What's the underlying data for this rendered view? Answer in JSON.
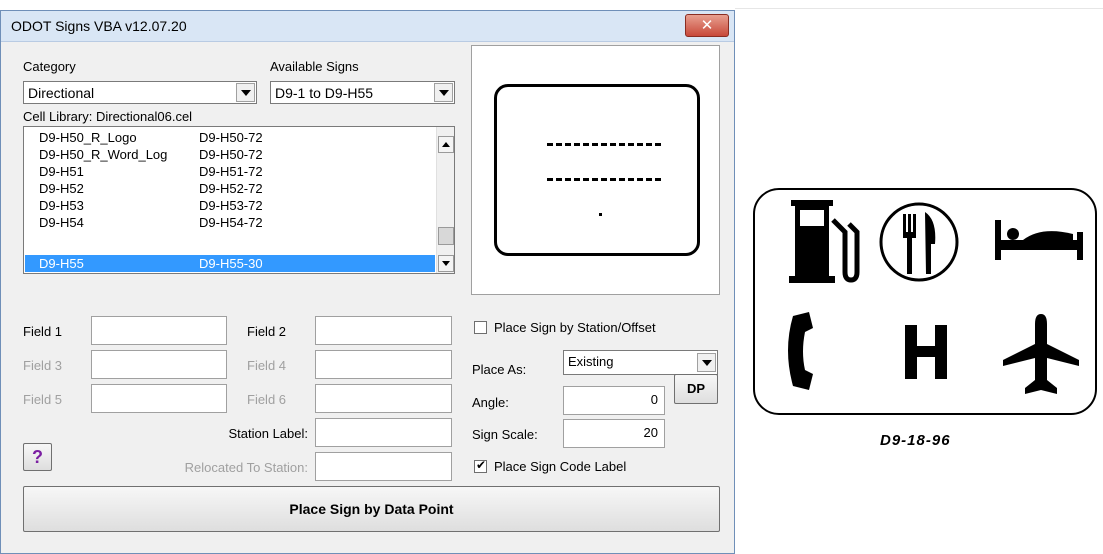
{
  "window": {
    "title": "ODOT Signs VBA  v12.07.20",
    "close_label": "✕"
  },
  "category": {
    "label": "Category",
    "value": "Directional"
  },
  "available_signs": {
    "label": "Available Signs",
    "value": "D9-1 to D9-H55"
  },
  "cell_library": {
    "label": "Cell Library:  Directional06.cel"
  },
  "sign_list": {
    "rows": [
      {
        "name": "D9-H50_R_Logo",
        "code": "D9-H50-72"
      },
      {
        "name": "D9-H50_R_Word_Log",
        "code": "D9-H50-72"
      },
      {
        "name": "D9-H51",
        "code": "D9-H51-72"
      },
      {
        "name": "D9-H52",
        "code": "D9-H52-72"
      },
      {
        "name": "D9-H53",
        "code": "D9-H53-72"
      },
      {
        "name": "D9-H54",
        "code": "D9-H54-72"
      },
      {
        "name": "D9-H55",
        "code": "D9-H55-30"
      }
    ],
    "selected": "D9-H55"
  },
  "fields": {
    "field1": "Field 1",
    "field2": "Field 2",
    "field3": "Field 3",
    "field4": "Field 4",
    "field5": "Field 5",
    "field6": "Field 6",
    "station_label": "Station Label:",
    "relocated_to_station": "Relocated To Station:"
  },
  "placement": {
    "station_offset_label": "Place Sign by Station/Offset",
    "station_offset_checked": false,
    "place_as_label": "Place As:",
    "place_as_value": "Existing",
    "angle_label": "Angle:",
    "angle_value": "0",
    "dp_label": "DP",
    "scale_label": "Sign Scale:",
    "scale_value": "20",
    "code_label_label": "Place Sign Code Label",
    "code_label_checked": true
  },
  "help_label": "?",
  "place_button_label": "Place Sign by Data Point",
  "sign_drawing": {
    "code": "D9-18-96",
    "icons": [
      "gas-pump-icon",
      "fork-knife-icon",
      "bed-icon",
      "phone-icon",
      "hospital-icon",
      "airplane-icon"
    ],
    "hospital_letter": "H"
  },
  "colors": {
    "selection": "#3399ff",
    "close": "#c8493a",
    "help": "#7b1fa2"
  }
}
